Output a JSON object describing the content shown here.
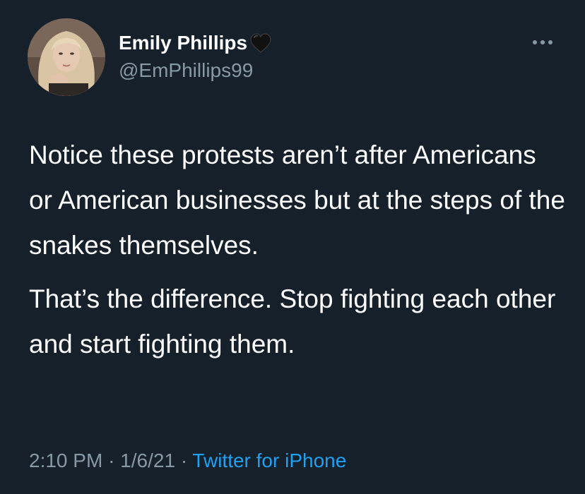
{
  "user": {
    "display_name": "Emily Phillips",
    "handle": "@EmPhillips99",
    "name_emoji": "black-heart-icon"
  },
  "tweet": {
    "paragraphs": [
      "Notice these protests aren’t after Americans or American businesses but at the steps of the snakes themselves.",
      "That’s the difference. Stop fighting each other and start fighting them."
    ],
    "time": "2:10 PM",
    "separator": "·",
    "date": "1/6/21",
    "source": "Twitter for iPhone"
  },
  "colors": {
    "background": "#15202b",
    "text": "#ffffff",
    "secondary": "#8899a6",
    "link": "#1da1f2"
  },
  "icons": {
    "more": "more-dots-icon",
    "avatar": "avatar"
  }
}
